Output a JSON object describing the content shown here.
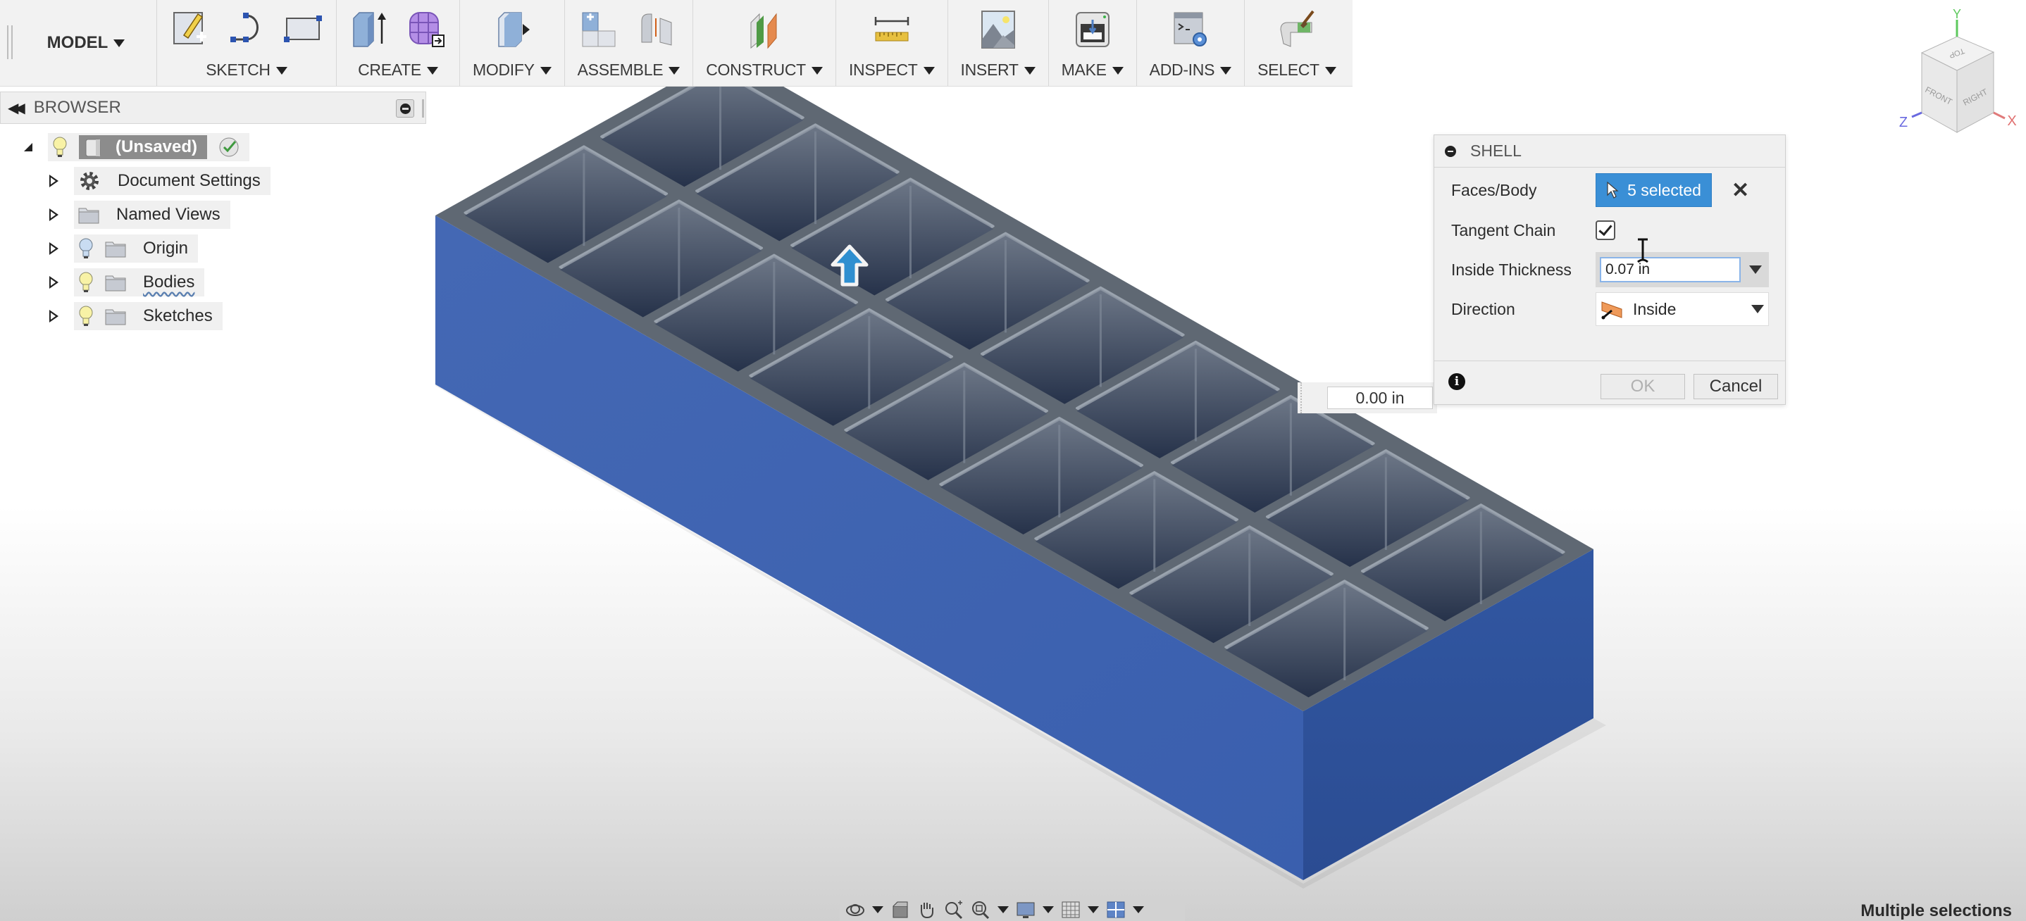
{
  "toolbar": {
    "workspace": "MODEL",
    "groups": [
      {
        "label": "SKETCH",
        "icons": [
          "create-sketch-icon",
          "arc-icon",
          "rectangle-icon"
        ]
      },
      {
        "label": "CREATE",
        "icons": [
          "extrude-icon",
          "form-icon"
        ]
      },
      {
        "label": "MODIFY",
        "icons": [
          "press-pull-icon"
        ]
      },
      {
        "label": "ASSEMBLE",
        "icons": [
          "new-component-icon",
          "joint-icon"
        ]
      },
      {
        "label": "CONSTRUCT",
        "icons": [
          "offset-plane-icon"
        ]
      },
      {
        "label": "INSPECT",
        "icons": [
          "measure-icon"
        ]
      },
      {
        "label": "INSERT",
        "icons": [
          "insert-image-icon"
        ]
      },
      {
        "label": "MAKE",
        "icons": [
          "3d-print-icon"
        ]
      },
      {
        "label": "ADD-INS",
        "icons": [
          "scripts-addins-icon"
        ]
      },
      {
        "label": "SELECT",
        "icons": [
          "select-paint-icon"
        ]
      }
    ]
  },
  "browser": {
    "title": "BROWSER",
    "root": {
      "label": "(Unsaved)"
    },
    "items": [
      {
        "label": "Document Settings",
        "icon": "gear-icon"
      },
      {
        "label": "Named Views",
        "icon": "folder-icon"
      },
      {
        "label": "Origin",
        "icon": "folder-icon",
        "visibility": "hidden-bulb"
      },
      {
        "label": "Bodies",
        "icon": "folder-icon",
        "visibility": "visible-bulb"
      },
      {
        "label": "Sketches",
        "icon": "folder-icon",
        "visibility": "visible-bulb"
      }
    ]
  },
  "shell_dialog": {
    "title": "SHELL",
    "faces_body_label": "Faces/Body",
    "faces_body_value": "5 selected",
    "tangent_chain_label": "Tangent Chain",
    "tangent_chain_checked": true,
    "inside_thickness_label": "Inside Thickness",
    "inside_thickness_value": "0.07 in",
    "direction_label": "Direction",
    "direction_value": "Inside",
    "ok_label": "OK",
    "cancel_label": "Cancel"
  },
  "viewport": {
    "dimension_readout": "0.00 in",
    "model": {
      "pocket_rows": 9,
      "pocket_cols": 2,
      "side_color": "#3f66b2",
      "top_color": "#5f6873",
      "pocket_color": "#3a4556"
    },
    "viewcube": {
      "faces": [
        "TOP",
        "FRONT",
        "RIGHT"
      ],
      "axes": [
        "X",
        "Y",
        "Z"
      ]
    },
    "status_text": "Multiple selections"
  },
  "colors": {
    "accent": "#3a8fd6",
    "manipulator": "#2f8fd0"
  }
}
